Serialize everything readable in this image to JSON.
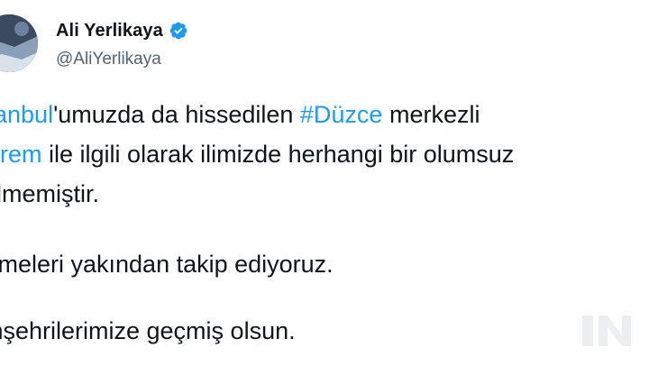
{
  "author": {
    "display_name": "Ali Yerlikaya",
    "handle": "@AliYerlikaya",
    "verified": true,
    "verified_icon": "verified-badge-icon"
  },
  "tweet": {
    "line1": {
      "mention": "stanbul",
      "rest_a": "'umuzda da hissedilen ",
      "hashtag": "#Düzce",
      "rest_b": " merkezli"
    },
    "line2": {
      "mention": "eprem",
      "rest": " ile ilgili olarak ilimizde herhangi bir olumsuz"
    },
    "line3": "irilmemiştir.",
    "line4": "işmeleri yakından takip ediyoruz.",
    "line5": "mşehrilerimize geçmiş olsun."
  },
  "colors": {
    "link": "#1d9bf0",
    "text": "#0f1419",
    "secondary": "#536471"
  }
}
